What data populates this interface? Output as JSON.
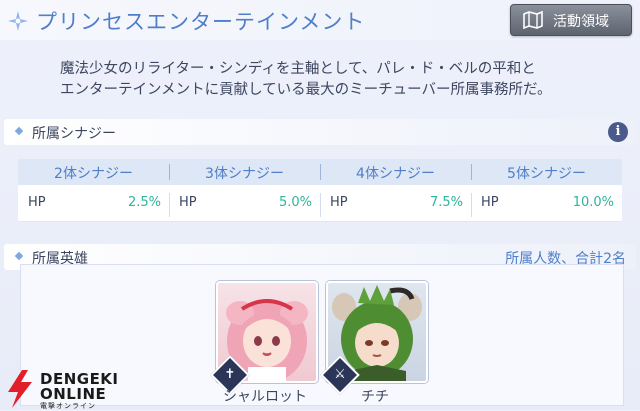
{
  "header": {
    "title": "プリンセスエンターテインメント",
    "map_button_label": "活動領域"
  },
  "description": {
    "line1": "魔法少女のリライター・シンディを主軸として、パレ・ド・ベルの平和と",
    "line2": "エンターテインメントに貢献している最大のミーチューバー所属事務所だ。"
  },
  "synergy": {
    "section_title": "所属シナジー",
    "columns": [
      {
        "header": "2体シナジー",
        "stat": "HP",
        "value": "2.5%"
      },
      {
        "header": "3体シナジー",
        "stat": "HP",
        "value": "5.0%"
      },
      {
        "header": "4体シナジー",
        "stat": "HP",
        "value": "7.5%"
      },
      {
        "header": "5体シナジー",
        "stat": "HP",
        "value": "10.0%"
      }
    ]
  },
  "heroes": {
    "section_title": "所属英雄",
    "member_count": "所属人数、合計2名",
    "list": [
      {
        "name": "シャルロット",
        "class_icon": "cross-icon"
      },
      {
        "name": "チチ",
        "class_icon": "crossed-axes-icon"
      }
    ]
  },
  "watermark": {
    "line1": "DENGEKI",
    "line2": "ONLINE",
    "line3": "電撃オンライン"
  },
  "colors": {
    "accent_blue": "#4e7fc8",
    "synergy_value": "#2fb59a",
    "badge_dark": "#2b3558"
  }
}
